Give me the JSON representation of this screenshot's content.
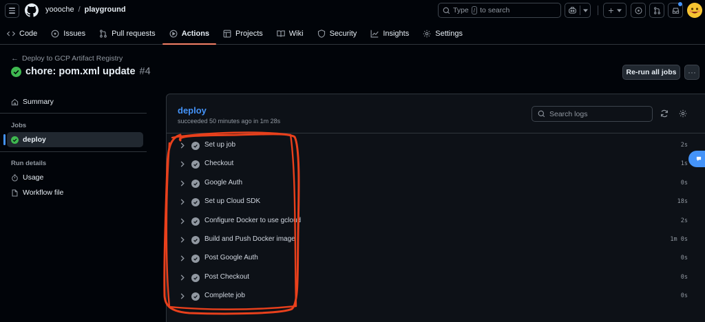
{
  "header": {
    "owner": "yoooche",
    "separator": "/",
    "repo": "playground",
    "search_prefix": "Type",
    "search_key": "/",
    "search_suffix": "to search",
    "icons": [
      "hamburger-icon",
      "github-logo",
      "copilot-icon",
      "plus-icon",
      "issues-icon",
      "pull-request-icon",
      "inbox-icon"
    ],
    "notification_color": "#4493f8"
  },
  "tabs": [
    {
      "label": "Code",
      "icon": "code-icon"
    },
    {
      "label": "Issues",
      "icon": "issue-icon"
    },
    {
      "label": "Pull requests",
      "icon": "pull-request-icon"
    },
    {
      "label": "Actions",
      "icon": "play-icon",
      "active": true
    },
    {
      "label": "Projects",
      "icon": "table-icon"
    },
    {
      "label": "Wiki",
      "icon": "book-icon"
    },
    {
      "label": "Security",
      "icon": "shield-icon"
    },
    {
      "label": "Insights",
      "icon": "graph-icon"
    },
    {
      "label": "Settings",
      "icon": "gear-icon"
    }
  ],
  "run": {
    "workflow_link": "Deploy to GCP Artifact Registry",
    "title": "chore: pom.xml update",
    "number": "#4",
    "rerun_label": "Re-run all jobs",
    "more_label": "···",
    "status_color": "#3fb950"
  },
  "sidebar": {
    "summary": "Summary",
    "jobs_heading": "Jobs",
    "job": "deploy",
    "run_details_heading": "Run details",
    "usage": "Usage",
    "workflow_file": "Workflow file"
  },
  "job": {
    "name": "deploy",
    "meta": "succeeded 50 minutes ago in 1m 28s",
    "search_placeholder": "Search logs",
    "steps": [
      {
        "name": "Set up job",
        "duration": "2s"
      },
      {
        "name": "Checkout",
        "duration": "1s"
      },
      {
        "name": "Google Auth",
        "duration": "0s"
      },
      {
        "name": "Set up Cloud SDK",
        "duration": "18s"
      },
      {
        "name": "Configure Docker to use gcloud",
        "duration": "2s"
      },
      {
        "name": "Build and Push Docker image",
        "duration": "1m 0s"
      },
      {
        "name": "Post Google Auth",
        "duration": "0s"
      },
      {
        "name": "Post Checkout",
        "duration": "0s"
      },
      {
        "name": "Complete job",
        "duration": "0s"
      }
    ]
  },
  "annotation_color": "#e8401c",
  "accent_color": "#f78166",
  "link_color": "#4493f8"
}
